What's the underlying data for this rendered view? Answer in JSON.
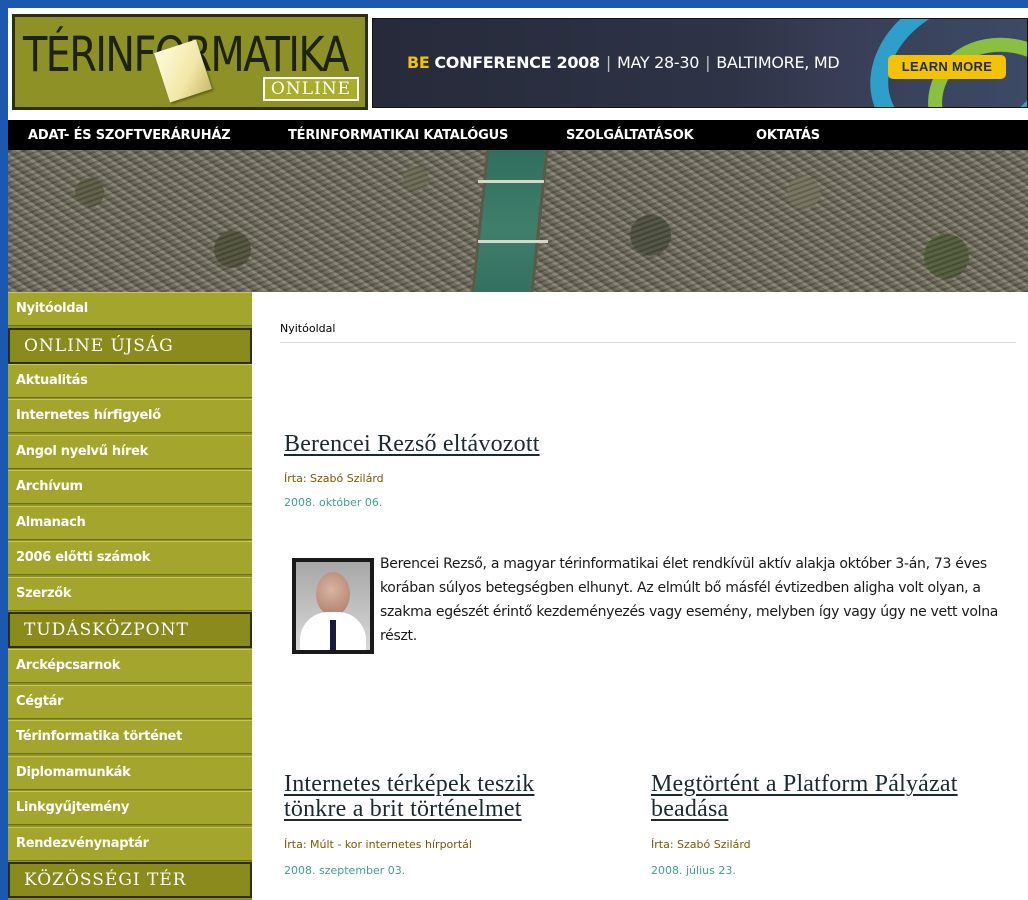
{
  "header": {
    "logo_main": "TÉRINFORMATIKA",
    "logo_sub": "ONLINE",
    "banner": {
      "be": "BE",
      "conference": "CONFERENCE 2008",
      "dates": "MAY 28-30",
      "location": "BALTIMORE, MD",
      "cta": "LEARN MORE"
    }
  },
  "nav": {
    "items": [
      "ADAT- ÉS SZOFTVERÁRUHÁZ",
      "TÉRINFORMATIKAI KATALÓGUS",
      "SZOLGÁLTATÁSOK",
      "OKTATÁS"
    ]
  },
  "sidebar": {
    "home": "Nyitóoldal",
    "sections": [
      {
        "title": "ONLINE ÚJSÁG",
        "items": [
          "Aktualitás",
          "Internetes hírfigyelő",
          "Angol nyelvű hírek",
          "Archívum",
          "Almanach",
          "2006 előtti számok",
          "Szerzők"
        ]
      },
      {
        "title": "TUDÁSKÖZPONT",
        "items": [
          "Arcképcsarnok",
          "Cégtár",
          "Térinformatika történet",
          "Diplomamunkák",
          "Linkgyűjtemény",
          "Rendezvénynaptár"
        ]
      },
      {
        "title": "KÖZÖSSÉGI TÉR",
        "items": []
      }
    ]
  },
  "content": {
    "breadcrumb": "Nyitóoldal",
    "featured": {
      "title": "Berencei Rezső eltávozott",
      "author": "Írta: Szabó Szilárd",
      "date": "2008. október 06.",
      "body": "Berencei Rezső, a magyar térinformatikai élet rendkívül aktív alakja október 3-án, 73 éves korában súlyos betegségben elhunyt. Az elmúlt bő másfél évtizedben aligha volt olyan, a szakma egészét érintő kezdeményezés vagy esemény, melyben így vagy úgy ne vett volna részt."
    },
    "articles": [
      {
        "title_line1": "Internetes térképek teszik",
        "title_line2": "tönkre a brit történelmet",
        "author": "Írta: Múlt - kor internetes hírportál",
        "date": "2008. szeptember 03."
      },
      {
        "title_line1": "Megtörtént a Platform Pályázat",
        "title_line2": "beadása",
        "author": "Írta: Szabó Szilárd",
        "date": "2008. július 23."
      }
    ]
  },
  "colors": {
    "desktop": "#1c58b0",
    "sidebar_item": "#a4a52c",
    "sidebar_head": "#8a8a1d",
    "nav": "#000000",
    "date": "#44a08c",
    "author": "#7a5a00"
  }
}
